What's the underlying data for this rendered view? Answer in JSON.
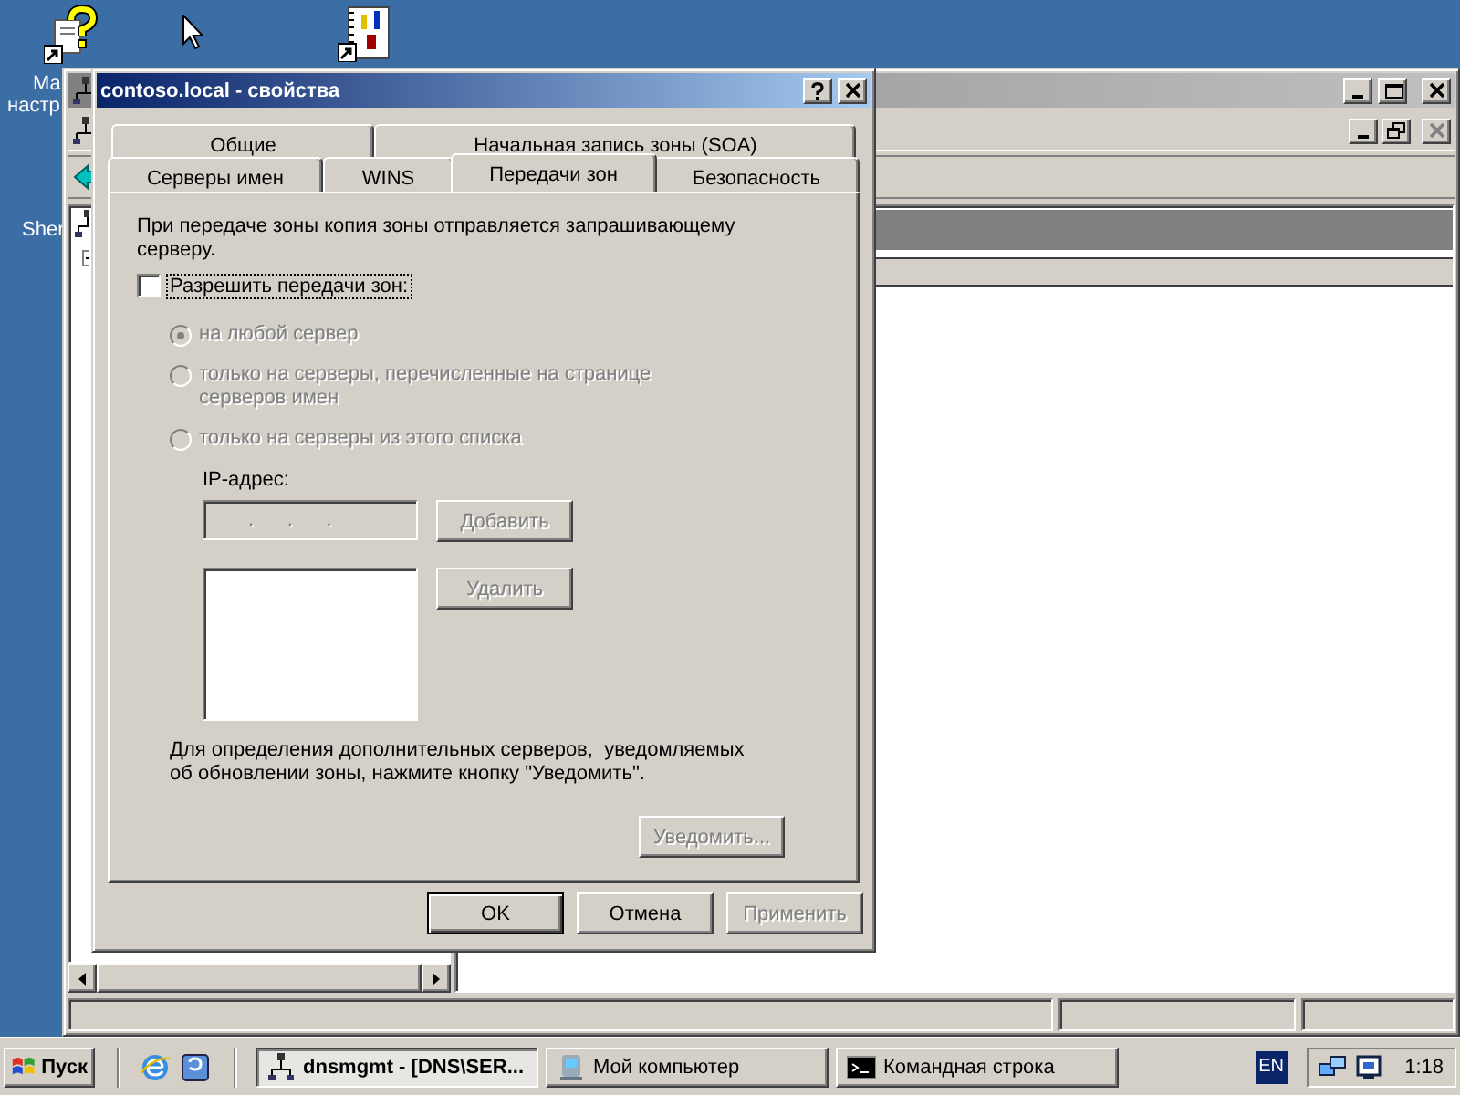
{
  "desktop_icons": [
    {
      "kind": "help",
      "label": [
        "Ма",
        "настр"
      ]
    },
    {
      "kind": "notebook"
    },
    {
      "kind": "label_only",
      "label": [
        "Sher"
      ]
    }
  ],
  "mmc_window": {
    "mdi_buttons": [
      {
        "kind": "minimize",
        "disabled": false
      },
      {
        "kind": "restore",
        "disabled": false
      },
      {
        "kind": "close",
        "disabled": true
      }
    ]
  },
  "dialog": {
    "title": "contoso.local - свойства",
    "tab_rows": [
      [
        {
          "label": "Общие",
          "selected": false
        },
        {
          "label": "Начальная запись зоны (SOA)",
          "selected": false
        }
      ],
      [
        {
          "label": "Серверы имен",
          "selected": false
        },
        {
          "label": "WINS",
          "selected": false
        },
        {
          "label": "Передачи зон",
          "selected": true
        },
        {
          "label": "Безопасность",
          "selected": false
        }
      ]
    ],
    "description": "При передаче зоны копия зоны отправляется запрашивающему серверу.",
    "allow_transfers": {
      "label": "Разрешить передачи зон:",
      "checked": false
    },
    "radios": [
      {
        "label": "на любой сервер",
        "selected": true,
        "disabled": true
      },
      {
        "label": "только на серверы, перечисленные на странице серверов имен",
        "selected": false,
        "disabled": true
      },
      {
        "label": "только на серверы из этого списка",
        "selected": false,
        "disabled": true
      }
    ],
    "ip_label": "IP-адрес:",
    "ip_field": {
      "value": ".      .      .",
      "disabled": true
    },
    "add_button": {
      "label": "Добавить",
      "disabled": true
    },
    "remove_button": {
      "label": "Удалить",
      "disabled": true
    },
    "notify_text": "Для определения дополнительных серверов,  уведомляемых об обновлении зоны, нажмите кнопку \"Уведомить\".",
    "notify_button": {
      "label": "Уведомить...",
      "disabled": true
    },
    "buttons": [
      {
        "label": "OK",
        "default": true,
        "disabled": false
      },
      {
        "label": "Отмена",
        "default": false,
        "disabled": false
      },
      {
        "label": "Применить",
        "default": false,
        "disabled": true
      }
    ]
  },
  "taskbar": {
    "start": "Пуск",
    "tasks": [
      {
        "kind": "dns",
        "label": "dnsmgmt - [DNS\\SER...",
        "selected": true
      },
      {
        "kind": "computer",
        "label": "Мой компьютер",
        "selected": false
      },
      {
        "kind": "console",
        "label": "Командная строка",
        "selected": false
      }
    ],
    "language": "EN",
    "clock": "1:18"
  }
}
